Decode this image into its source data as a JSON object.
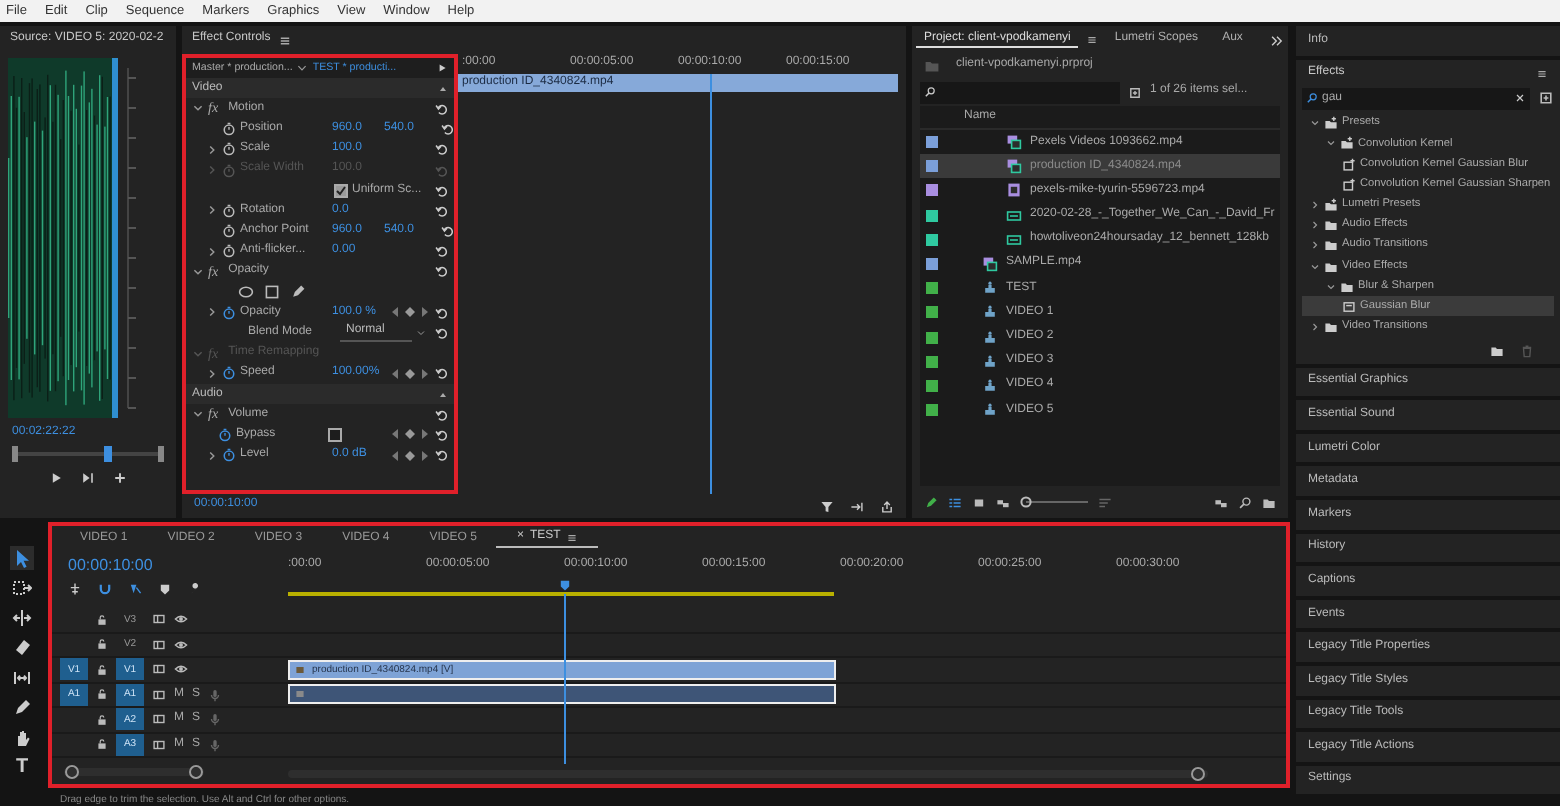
{
  "menu": [
    "File",
    "Edit",
    "Clip",
    "Sequence",
    "Markers",
    "Graphics",
    "View",
    "Window",
    "Help"
  ],
  "source": {
    "title": "Source: VIDEO 5: 2020-02-2",
    "timecode": "00:02:22:22"
  },
  "effect_controls": {
    "title": "Effect Controls",
    "master": "Master * production...",
    "sequence": "TEST * producti...",
    "ruler": [
      ":00:00",
      "00:00:05:00",
      "00:00:10:00",
      "00:00:15:00"
    ],
    "clip": "production ID_4340824.mp4",
    "timecode": "00:00:10:00",
    "rows": [
      {
        "kind": "section",
        "label": "Video"
      },
      {
        "kind": "effect",
        "badge": "fx",
        "label": "Motion",
        "expanded": true,
        "disabled": false
      },
      {
        "kind": "param",
        "label": "Position",
        "values": [
          "960.0",
          "540.0"
        ],
        "expandable": false,
        "disabled": false,
        "animated": false,
        "keyframes": false
      },
      {
        "kind": "param",
        "label": "Scale",
        "values": [
          "100.0"
        ],
        "expandable": true,
        "disabled": false,
        "animated": false,
        "keyframes": false
      },
      {
        "kind": "param",
        "label": "Scale Width",
        "values": [
          "100.0"
        ],
        "expandable": true,
        "disabled": true,
        "animated": false,
        "keyframes": false
      },
      {
        "kind": "checkbox",
        "label": "Uniform Sc...",
        "checked": true
      },
      {
        "kind": "param",
        "label": "Rotation",
        "values": [
          "0.0"
        ],
        "expandable": true,
        "disabled": false,
        "animated": false,
        "keyframes": false
      },
      {
        "kind": "param",
        "label": "Anchor Point",
        "values": [
          "960.0",
          "540.0"
        ],
        "expandable": false,
        "disabled": false,
        "animated": false,
        "keyframes": false
      },
      {
        "kind": "param",
        "label": "Anti-flicker...",
        "values": [
          "0.00"
        ],
        "expandable": true,
        "disabled": false,
        "animated": false,
        "keyframes": false
      },
      {
        "kind": "effect",
        "badge": "fx",
        "label": "Opacity",
        "expanded": true,
        "disabled": false
      },
      {
        "kind": "masks"
      },
      {
        "kind": "param",
        "label": "Opacity",
        "values": [
          "100.0 %"
        ],
        "expandable": true,
        "disabled": false,
        "animated": true,
        "keyframes": true
      },
      {
        "kind": "select",
        "label": "Blend Mode",
        "value": "Normal"
      },
      {
        "kind": "effect",
        "badge": "fx",
        "label": "Time Remapping",
        "expanded": true,
        "disabled": true
      },
      {
        "kind": "param",
        "label": "Speed",
        "values": [
          "100.00%"
        ],
        "expandable": true,
        "disabled": false,
        "animated": true,
        "keyframes": true
      },
      {
        "kind": "section",
        "label": "Audio"
      },
      {
        "kind": "effect",
        "badge": "fx",
        "label": "Volume",
        "expanded": true,
        "disabled": false
      },
      {
        "kind": "toggle",
        "label": "Bypass",
        "checked": false
      },
      {
        "kind": "param",
        "label": "Level",
        "values": [
          "0.0 dB"
        ],
        "expandable": true,
        "disabled": false,
        "animated": true,
        "keyframes": true
      }
    ]
  },
  "project": {
    "tabs": [
      {
        "label": "Project: client-vpodkamenyi",
        "selected": true
      },
      {
        "label": "Lumetri Scopes",
        "selected": false
      },
      {
        "label": "Aux",
        "selected": false
      }
    ],
    "file": "client-vpodkamenyi.prproj",
    "zoom": {
      "level": 0
    },
    "count": "1 of 26 items sel...",
    "column": "Name",
    "items": [
      {
        "children": [
          {
            "name": "Pexels Videos 1093662.mp4",
            "kind": "av",
            "color": "#7b9fd9",
            "selected": false
          },
          {
            "name": "production ID_4340824.mp4",
            "kind": "av",
            "color": "#7b9fd9",
            "selected": true
          },
          {
            "name": "pexels-mike-tyurin-5596723.mp4",
            "kind": "video",
            "color": "#a98ee0",
            "selected": false
          },
          {
            "name": "2020-02-28_-_Together_We_Can_-_David_Fr",
            "kind": "audio",
            "color": "#2fc9a0",
            "selected": false
          },
          {
            "name": "howtoliveon24hoursaday_12_bennett_128kb",
            "kind": "audio",
            "color": "#2fc9a0",
            "selected": false
          }
        ]
      },
      {
        "name": "SAMPLE.mp4",
        "kind": "av",
        "color": "#7b9fd9",
        "selected": false
      },
      {
        "name": "TEST",
        "kind": "sequence",
        "color": "#41b049",
        "selected": false
      },
      {
        "name": "VIDEO 1",
        "kind": "sequence",
        "color": "#41b049",
        "selected": false
      },
      {
        "name": "VIDEO 2",
        "kind": "sequence",
        "color": "#41b049",
        "selected": false
      },
      {
        "name": "VIDEO 3",
        "kind": "sequence",
        "color": "#41b049",
        "selected": false
      },
      {
        "name": "VIDEO 4",
        "kind": "sequence",
        "color": "#41b049",
        "selected": false
      },
      {
        "name": "VIDEO 5",
        "kind": "sequence",
        "color": "#41b049",
        "selected": false
      }
    ]
  },
  "info": {
    "title": "Info"
  },
  "effects": {
    "title": "Effects",
    "search": "gau",
    "tree": [
      {
        "label": "Presets",
        "kind": "preset-folder",
        "expanded": true,
        "selected": false,
        "children": [
          {
            "label": "Convolution Kernel",
            "kind": "preset-folder",
            "expanded": true,
            "selected": false,
            "children": [
              {
                "label": "Convolution Kernel Gaussian Blur",
                "kind": "preset",
                "selected": false
              },
              {
                "label": "Convolution Kernel Gaussian Sharpen",
                "kind": "preset",
                "selected": false
              }
            ]
          }
        ]
      },
      {
        "label": "Lumetri Presets",
        "kind": "preset-folder",
        "expanded": false,
        "selected": false
      },
      {
        "label": "Audio Effects",
        "kind": "folder",
        "expanded": false,
        "selected": false
      },
      {
        "label": "Audio Transitions",
        "kind": "folder",
        "expanded": false,
        "selected": false
      },
      {
        "label": "Video Effects",
        "kind": "folder",
        "expanded": true,
        "selected": false,
        "children": [
          {
            "label": "Blur & Sharpen",
            "kind": "folder",
            "expanded": true,
            "selected": false,
            "children": [
              {
                "label": "Gaussian Blur",
                "kind": "effect",
                "selected": true
              }
            ]
          }
        ]
      },
      {
        "label": "Video Transitions",
        "kind": "folder",
        "expanded": false,
        "selected": false
      }
    ]
  },
  "panels": [
    "Essential Graphics",
    "Essential Sound",
    "Lumetri Color",
    "Metadata",
    "Markers",
    "History",
    "Captions",
    "Events",
    "Legacy Title Properties",
    "Legacy Title Styles",
    "Legacy Title Tools",
    "Legacy Title Actions",
    "Settings"
  ],
  "tools": [
    {
      "kind": "selection",
      "selected": true
    },
    {
      "kind": "track-select",
      "selected": false
    },
    {
      "kind": "ripple",
      "selected": false
    },
    {
      "kind": "razor",
      "selected": false
    },
    {
      "kind": "slip",
      "selected": false
    },
    {
      "kind": "pen",
      "selected": false
    },
    {
      "kind": "hand",
      "selected": false
    },
    {
      "kind": "type",
      "label": "T",
      "selected": false
    }
  ],
  "timeline": {
    "tabs": [
      {
        "label": "VIDEO 1",
        "selected": false
      },
      {
        "label": "VIDEO 2",
        "selected": false
      },
      {
        "label": "VIDEO 3",
        "selected": false
      },
      {
        "label": "VIDEO 4",
        "selected": false
      },
      {
        "label": "VIDEO 5",
        "selected": false
      },
      {
        "label": "TEST",
        "selected": true,
        "close": "×"
      }
    ],
    "timecode": "00:00:10:00",
    "ruler": [
      ":00:00",
      "00:00:05:00",
      "00:00:10:00",
      "00:00:15:00",
      "00:00:20:00",
      "00:00:25:00",
      "00:00:30:00"
    ],
    "tracks": [
      {
        "kind": "video",
        "name": "V3",
        "targeted": false
      },
      {
        "kind": "video",
        "name": "V2",
        "targeted": false
      },
      {
        "kind": "video",
        "name": "V1",
        "source": "V1",
        "targeted": true,
        "clip": {
          "label": "production ID_4340824.mp4 [V]",
          "selected": true
        }
      },
      {
        "kind": "audio",
        "name": "A1",
        "source": "A1",
        "targeted": true,
        "mute": "M",
        "solo": "S",
        "clip": {
          "selected": true
        }
      },
      {
        "kind": "audio",
        "name": "A2",
        "targeted": true,
        "mute": "M",
        "solo": "S"
      },
      {
        "kind": "audio",
        "name": "A3",
        "targeted": true,
        "mute": "M",
        "solo": "S"
      }
    ]
  },
  "status_bar": "Drag edge to trim the selection. Use Alt and Ctrl for other options."
}
